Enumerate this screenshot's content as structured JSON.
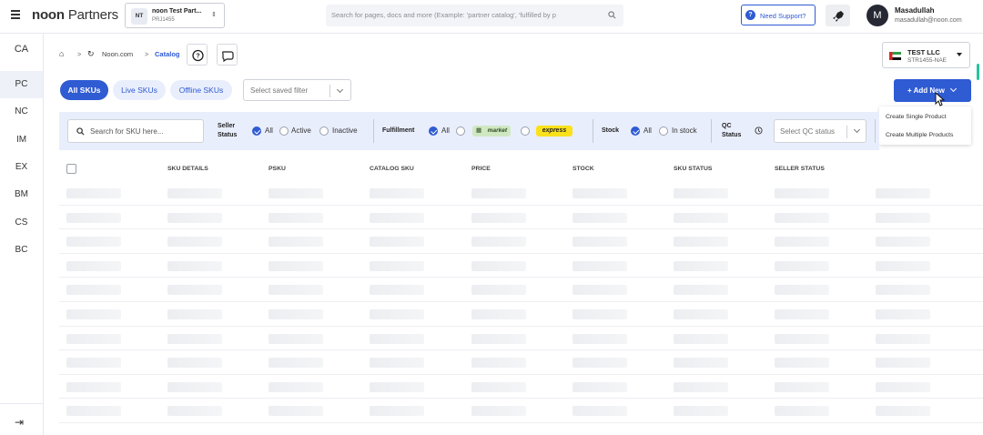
{
  "app": {
    "logo_bold": "noon",
    "logo_rest": " Partners"
  },
  "project": {
    "avatar": "NT",
    "name": "noon Test Part...",
    "id": "PRJ1455"
  },
  "search": {
    "placeholder": "Search for pages, docs and more (Example: 'partner catalog', 'fulfilled by p"
  },
  "support": {
    "label": "Need Support?"
  },
  "user": {
    "initial": "M",
    "name": "Masadullah",
    "email": "masadullah@noon.com"
  },
  "sidebar": {
    "items": [
      {
        "label": "CA"
      },
      {
        "label": "PC"
      },
      {
        "label": "NC"
      },
      {
        "label": "IM"
      },
      {
        "label": "EX"
      },
      {
        "label": "BM"
      },
      {
        "label": "CS"
      },
      {
        "label": "BC"
      }
    ],
    "active_index": 1
  },
  "breadcrumb": {
    "home": "⌂",
    "items": [
      "Noon.com",
      "Catalog"
    ]
  },
  "store": {
    "name": "TEST LLC",
    "code": "STR1455-NAE"
  },
  "tabs": [
    {
      "label": "All SKUs",
      "active": true
    },
    {
      "label": "Live SKUs",
      "active": false
    },
    {
      "label": "Offline SKUs",
      "active": false
    }
  ],
  "saved_filter": {
    "placeholder": "Select saved filter"
  },
  "add_new": {
    "label": "+ Add New",
    "menu": [
      "Create Single Product",
      "Create Multiple Products"
    ]
  },
  "filters": {
    "sku_search_placeholder": "Search for SKU here...",
    "seller_status": {
      "label_line1": "Seller",
      "label_line2": "Status",
      "options": [
        "All",
        "Active",
        "Inactive"
      ],
      "selected": "All"
    },
    "fulfillment": {
      "label": "Fulfillment",
      "option_all": "All",
      "market_badge": "market",
      "express_badge": "express",
      "selected": "All"
    },
    "stock": {
      "label": "Stock",
      "options": [
        "All",
        "In stock"
      ],
      "selected": "All"
    },
    "qc_status": {
      "label_line1": "QC",
      "label_line2": "Status",
      "placeholder": "Select QC status"
    }
  },
  "table": {
    "columns": [
      "SKU DETAILS",
      "PSKU",
      "CATALOG SKU",
      "PRICE",
      "STOCK",
      "SKU STATUS",
      "SELLER STATUS"
    ],
    "loading_rows": 10
  }
}
